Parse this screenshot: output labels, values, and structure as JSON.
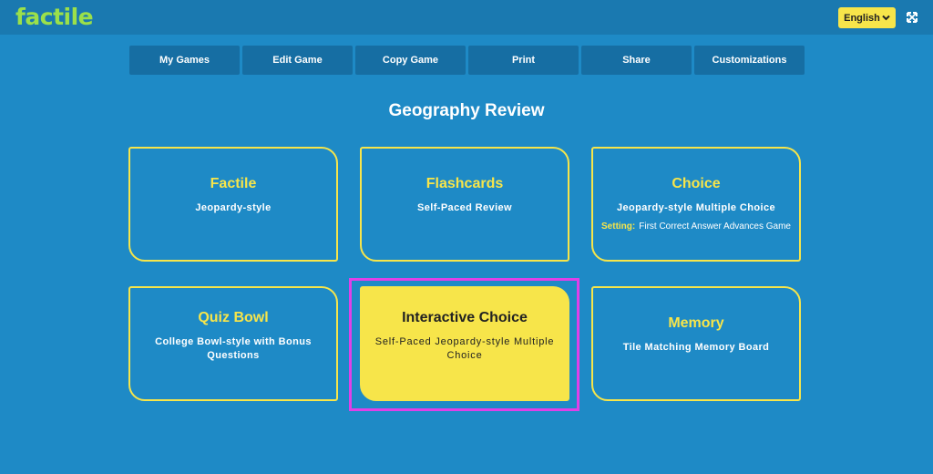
{
  "header": {
    "logo": "factile",
    "language": "English",
    "fullscreen_icon": "expand-icon"
  },
  "nav": {
    "items": [
      "My Games",
      "Edit Game",
      "Copy Game",
      "Print",
      "Share",
      "Customizations"
    ]
  },
  "page_title": "Geography Review",
  "modes": [
    {
      "name": "Factile",
      "desc": "Jeopardy-style"
    },
    {
      "name": "Flashcards",
      "desc": "Self-Paced Review"
    },
    {
      "name": "Choice",
      "desc": "Jeopardy-style Multiple Choice",
      "setting_label": "Setting:",
      "setting_value": "First Correct Answer Advances Game"
    },
    {
      "name": "Quiz Bowl",
      "desc": "College Bowl-style with Bonus Questions"
    },
    {
      "name": "Interactive Choice",
      "desc": "Self-Paced Jeopardy-style Multiple Choice",
      "selected": true
    },
    {
      "name": "Memory",
      "desc": "Tile Matching Memory Board"
    }
  ],
  "colors": {
    "background": "#1e8ac6",
    "accent_yellow": "#f7e54a",
    "logo_green": "#9be04a",
    "highlight_magenta": "#e040e8"
  }
}
